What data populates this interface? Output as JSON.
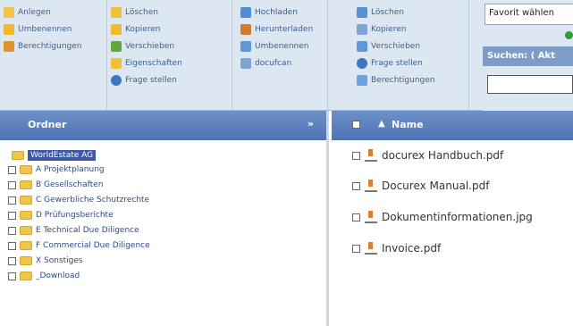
{
  "toolbar": {
    "groups": [
      {
        "items": [
          "Anlegen",
          "Umbenennen",
          "Berechtigungen"
        ]
      },
      {
        "items": [
          "Löschen",
          "Kopieren",
          "Verschieben",
          "Eigenschaften",
          "Frage stellen"
        ]
      },
      {
        "items": [
          "Hochladen",
          "Herunterladen",
          "Umbenennen",
          "docufcan"
        ]
      },
      {
        "items": [
          "Löschen",
          "Kopieren",
          "Verschieben",
          "Frage stellen",
          "Berechtigungen"
        ]
      }
    ],
    "favorite_label": "Favorit wählen",
    "search_label": "Suchen: ( Akt"
  },
  "folders_panel": {
    "title": "Ordner",
    "collapse_symbol": "»",
    "root": "WorldEstate AG",
    "items": [
      "A Projektplanung",
      "B Gesellschaften",
      "C Gewerbliche Schutzrechte",
      "D Prüfungsberichte",
      "E Technical Due Diligence",
      "F Commercial Due Diligence",
      "X Sonstiges",
      "_Download"
    ]
  },
  "files_panel": {
    "column_header": "Name",
    "sort_symbol": "▲",
    "files": [
      "docurex Handbuch.pdf",
      "Docurex Manual.pdf",
      "Dokumentinformationen.jpg",
      "Invoice.pdf"
    ]
  },
  "colors": {
    "toolbar": "#dde7f2",
    "panel_header": "#5b7fbc",
    "root_selected": "#3e58a6",
    "folder": "#f0c64a"
  }
}
